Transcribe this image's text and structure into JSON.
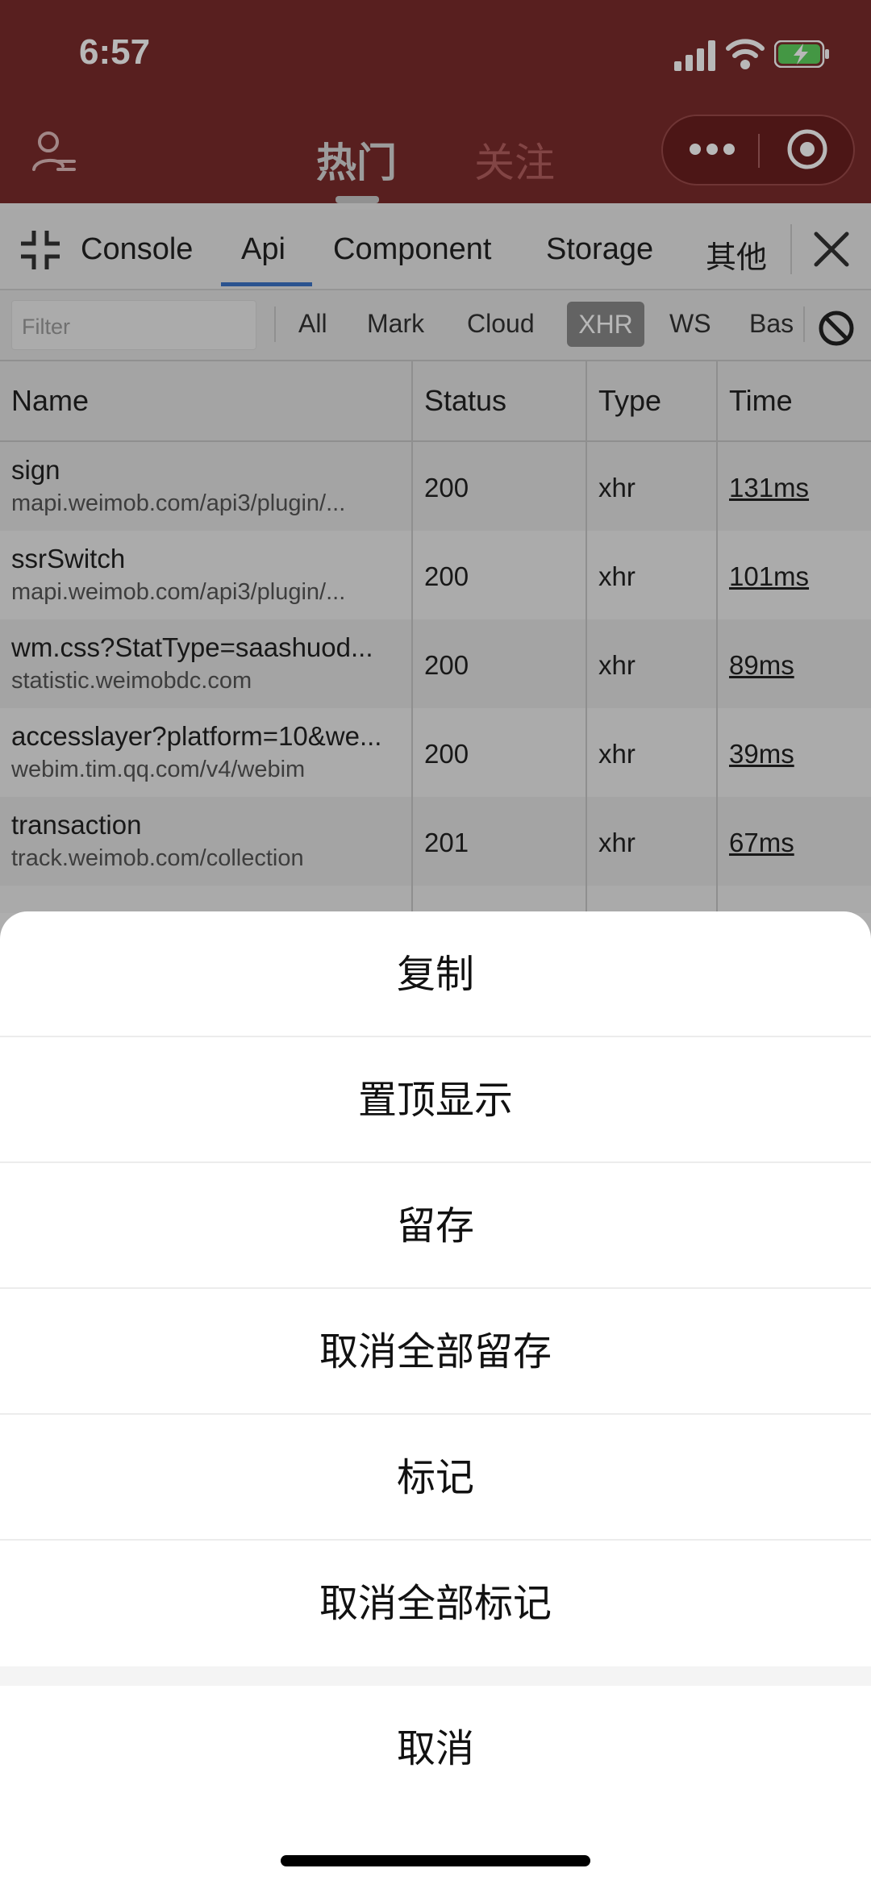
{
  "status_bar": {
    "time": "6:57"
  },
  "nav": {
    "tab_hot": "热门",
    "tab_follow": "关注"
  },
  "devtools": {
    "tabs": [
      "Console",
      "Api",
      "Component",
      "Storage",
      "其他"
    ],
    "active_tab": "Api",
    "filter_placeholder": "Filter",
    "chips": [
      "All",
      "Mark",
      "Cloud",
      "XHR",
      "WS",
      "Bas"
    ],
    "active_chip": "XHR",
    "columns": [
      "Name",
      "Status",
      "Type",
      "Time"
    ],
    "rows": [
      {
        "name": "sign",
        "url": "mapi.weimob.com/api3/plugin/...",
        "status": "200",
        "type": "xhr",
        "time": "131ms"
      },
      {
        "name": "ssrSwitch",
        "url": "mapi.weimob.com/api3/plugin/...",
        "status": "200",
        "type": "xhr",
        "time": "101ms"
      },
      {
        "name": "wm.css?StatType=saashuod...",
        "url": "statistic.weimobdc.com",
        "status": "200",
        "type": "xhr",
        "time": "89ms"
      },
      {
        "name": "accesslayer?platform=10&we...",
        "url": "webim.tim.qq.com/v4/webim",
        "status": "200",
        "type": "xhr",
        "time": "39ms"
      },
      {
        "name": "transaction",
        "url": "track.weimob.com/collection",
        "status": "201",
        "type": "xhr",
        "time": "67ms"
      }
    ]
  },
  "action_sheet": {
    "items": [
      "复制",
      "置顶显示",
      "留存",
      "取消全部留存",
      "标记",
      "取消全部标记"
    ],
    "cancel": "取消"
  },
  "colors": {
    "header": "#7a2b2b",
    "tab_underline": "#3c73c7",
    "chip_active": "#8a8a8a"
  }
}
